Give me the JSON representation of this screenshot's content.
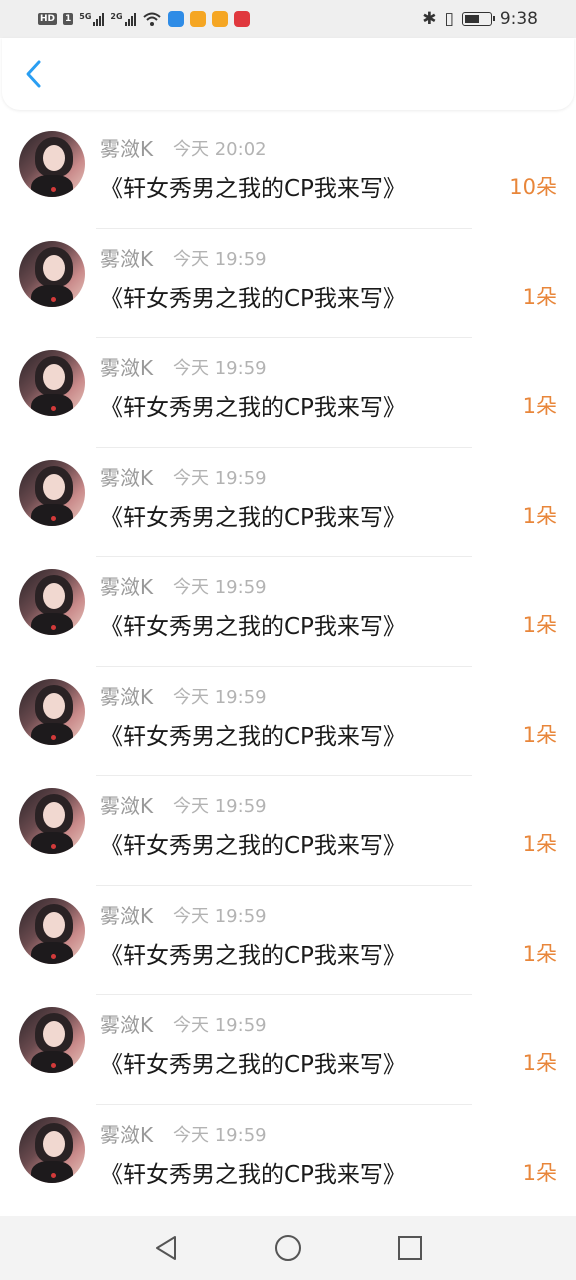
{
  "status_bar": {
    "hd_label": "HD",
    "sim_label": "1",
    "signal1_label": "5G",
    "signal2_label": "2G",
    "time": "9:38",
    "app_icon_colors": [
      "#2f8ce6",
      "#f5a623",
      "#f5a623",
      "#e0383e"
    ]
  },
  "header": {
    "back_icon": "chevron-left-icon",
    "accent_color": "#2a9ef2"
  },
  "gifts": [
    {
      "name": "雾潋K",
      "time": "今天 20:02",
      "title": "《轩女秀男之我的CP我来写》",
      "count": "10朵"
    },
    {
      "name": "雾潋K",
      "time": "今天 19:59",
      "title": "《轩女秀男之我的CP我来写》",
      "count": "1朵"
    },
    {
      "name": "雾潋K",
      "time": "今天 19:59",
      "title": "《轩女秀男之我的CP我来写》",
      "count": "1朵"
    },
    {
      "name": "雾潋K",
      "time": "今天 19:59",
      "title": "《轩女秀男之我的CP我来写》",
      "count": "1朵"
    },
    {
      "name": "雾潋K",
      "time": "今天 19:59",
      "title": "《轩女秀男之我的CP我来写》",
      "count": "1朵"
    },
    {
      "name": "雾潋K",
      "time": "今天 19:59",
      "title": "《轩女秀男之我的CP我来写》",
      "count": "1朵"
    },
    {
      "name": "雾潋K",
      "time": "今天 19:59",
      "title": "《轩女秀男之我的CP我来写》",
      "count": "1朵"
    },
    {
      "name": "雾潋K",
      "time": "今天 19:59",
      "title": "《轩女秀男之我的CP我来写》",
      "count": "1朵"
    },
    {
      "name": "雾潋K",
      "time": "今天 19:59",
      "title": "《轩女秀男之我的CP我来写》",
      "count": "1朵"
    },
    {
      "name": "雾潋K",
      "time": "今天 19:59",
      "title": "《轩女秀男之我的CP我来写》",
      "count": "1朵"
    }
  ],
  "colors": {
    "count_color": "#e8863a",
    "name_color": "#9a9a9a"
  }
}
